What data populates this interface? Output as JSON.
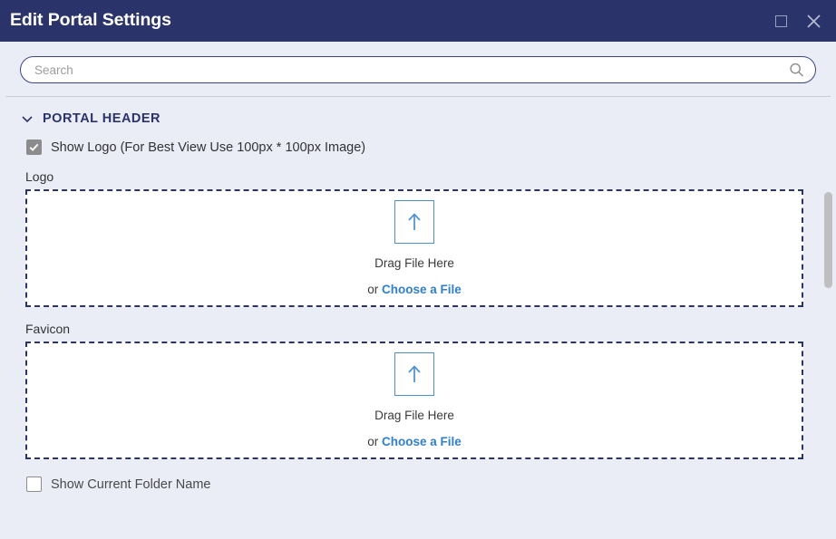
{
  "window": {
    "title": "Edit Portal Settings",
    "titlebar_bg": "#2b336b",
    "body_bg": "#eaedf6",
    "controls": {
      "maximize_name": "maximize-icon",
      "close_label": "✕"
    }
  },
  "search": {
    "placeholder": "Search",
    "value": "",
    "icon": "search-icon"
  },
  "sections": [
    {
      "title": "PORTAL HEADER",
      "expanded": true,
      "chevron": "chevron-down-icon"
    }
  ],
  "show_logo": {
    "label": "Show Logo (For Best View Use 100px * 100px Image)",
    "checked": true
  },
  "logo": {
    "label": "Logo",
    "drag_text": "Drag File Here",
    "or_text": "or ",
    "choose_link": "Choose a File",
    "upload_icon": "upload-arrow-icon"
  },
  "favicon": {
    "label": "Favicon",
    "drag_text": "Drag File Here",
    "or_text": "or ",
    "choose_link": "Choose a File",
    "upload_icon": "upload-arrow-icon"
  },
  "show_current_folder": {
    "label": "Show Current Folder Name",
    "checked": false
  },
  "colors": {
    "navy": "#2b336b",
    "link_blue": "#2f7fd0",
    "upload_blue": "#4a90d9",
    "background": "#eaedf6",
    "panel_white": "#ffffff"
  }
}
